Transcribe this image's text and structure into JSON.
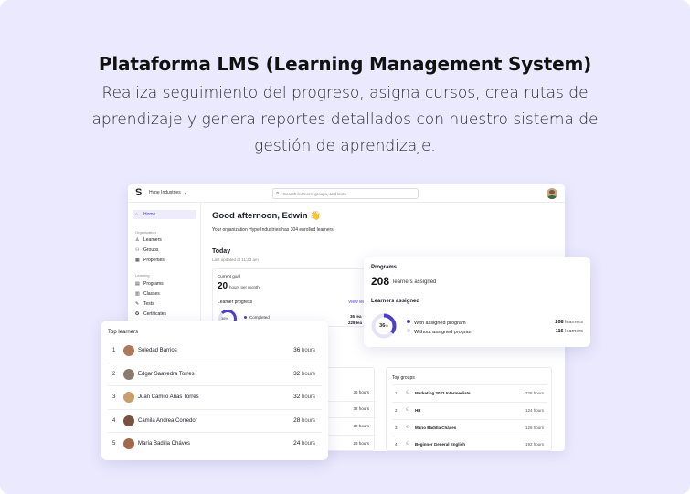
{
  "headline": "Plataforma LMS (Learning Management System)",
  "subheadline": "Realiza seguimiento del progreso, asigna cursos, crea rutas de aprendizaje y genera reportes detallados con nuestro sistema de gestión de aprendizaje.",
  "app": {
    "logo": "S",
    "org_name": "Hype Industries",
    "search_placeholder": "Search learners, groups, and tests",
    "sidebar": {
      "home": "Home",
      "organization_section": "Organization",
      "organization_items": [
        "Learners",
        "Groups",
        "Properties"
      ],
      "learning_section": "Learning",
      "learning_items": [
        "Programs",
        "Classes",
        "Tests",
        "Certificates"
      ]
    },
    "greeting": "Good afternoon, Edwin 👋",
    "greeting_sub": "Your organization Hype Industries has 304 enrolled learners.",
    "today": "Today",
    "last_updated": "Last updated at 11:43 am",
    "current_goal": {
      "label": "Current goal",
      "value": "20",
      "unit": "hours per month"
    },
    "learner_progress": {
      "label": "Learner progress",
      "view_link": "View lea",
      "ring_pct": "36%",
      "completed_label": "Completed",
      "values": [
        "36 lea",
        "228 lea"
      ]
    },
    "mid_values": [
      "36 hours",
      "32 hours",
      "32 hours",
      "28 hours"
    ],
    "top_groups": {
      "title": "Top groups",
      "rows": [
        {
          "rank": "1",
          "name": "Marketing 2022 Intermediate",
          "value": "228 hours"
        },
        {
          "rank": "2",
          "name": "HR",
          "value": "124 hours"
        },
        {
          "rank": "3",
          "name": "Mario Badilla Cháves",
          "value": "126 hours"
        },
        {
          "rank": "4",
          "name": "Beginner General English",
          "value": "192 hours"
        }
      ]
    }
  },
  "programs_card": {
    "title": "Programs",
    "count": "208",
    "count_unit": "learners assigned",
    "section": "Learners assigned",
    "ring_pct": "36",
    "ring_fraction": 0.36,
    "rows": [
      {
        "label": "With assigned program",
        "value": "208",
        "unit": "learners",
        "color": "#4b3fc9"
      },
      {
        "label": "Without assigned program",
        "value": "116",
        "unit": "learners",
        "color": "#d9d6f5"
      }
    ]
  },
  "top_learners": {
    "title": "Top learners",
    "rows": [
      {
        "rank": "1",
        "name": "Soledad Barrios",
        "hours": "36",
        "unit": "hours",
        "avatar_color": "#b07a5a"
      },
      {
        "rank": "2",
        "name": "Edgar Saavedra Torres",
        "hours": "32",
        "unit": "hours",
        "avatar_color": "#8a7a70"
      },
      {
        "rank": "3",
        "name": "Juan Camilo Arias Torres",
        "hours": "32",
        "unit": "hours",
        "avatar_color": "#c8a070"
      },
      {
        "rank": "4",
        "name": "Camila Andrea Corredor",
        "hours": "28",
        "unit": "hours",
        "avatar_color": "#7a5040"
      },
      {
        "rank": "5",
        "name": "María Badilla Cháves",
        "hours": "24",
        "unit": "hours",
        "avatar_color": "#a0684c"
      }
    ]
  },
  "colors": {
    "background": "#ebe9fd",
    "accent": "#4b3fc9"
  }
}
